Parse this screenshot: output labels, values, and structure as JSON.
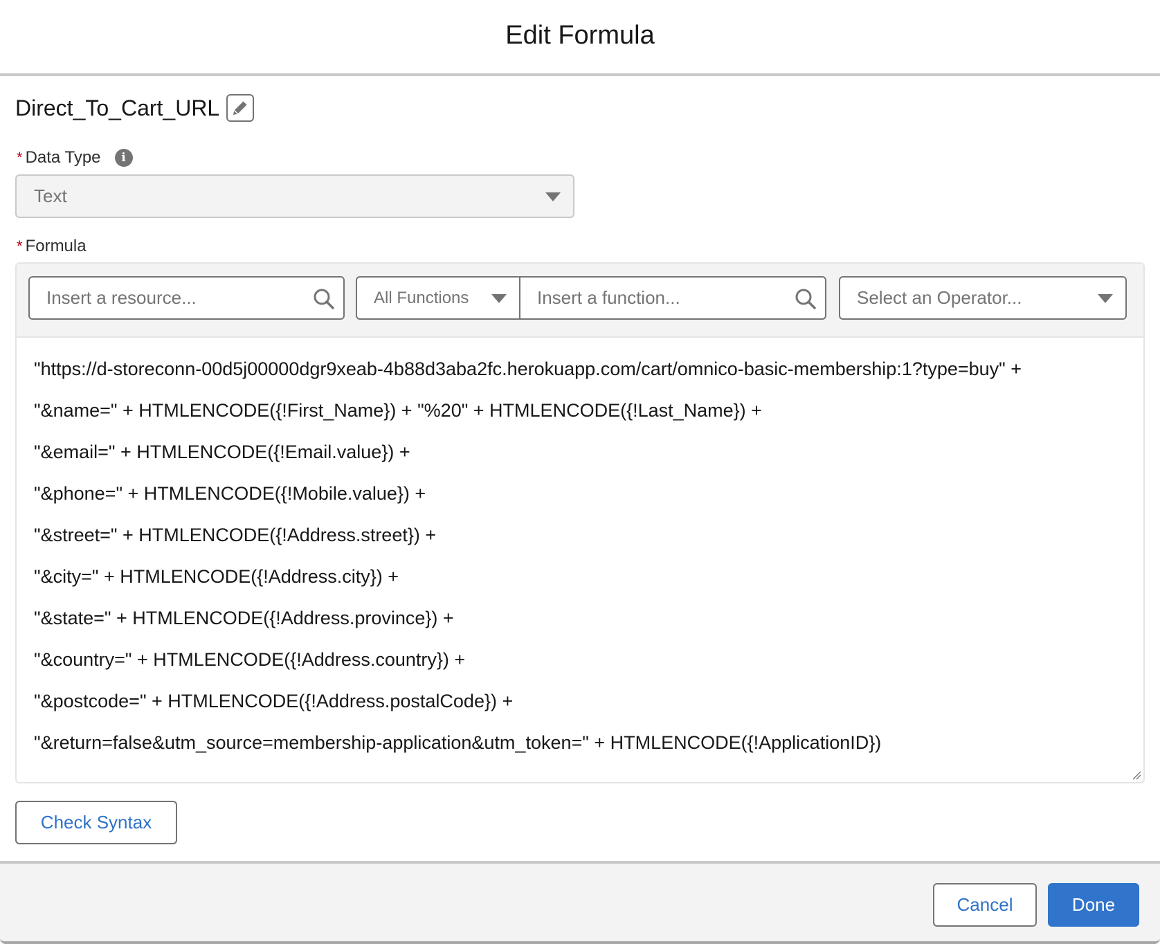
{
  "modal": {
    "title": "Edit Formula"
  },
  "field": {
    "api_name": "Direct_To_Cart_URL",
    "edit_icon": "pencil-icon"
  },
  "data_type": {
    "label": "Data Type",
    "required_marker": "*",
    "info_icon": "info-icon",
    "selected": "Text"
  },
  "formula": {
    "label": "Formula",
    "required_marker": "*",
    "toolbar": {
      "resource_placeholder": "Insert a resource...",
      "function_category": "All Functions",
      "function_placeholder": "Insert a function...",
      "operator_placeholder": "Select an Operator..."
    },
    "lines": [
      "\"https://d-storeconn-00d5j00000dgr9xeab-4b88d3aba2fc.herokuapp.com/cart/omnico-basic-membership:1?type=buy\" +",
      "\"&name=\" + HTMLENCODE({!First_Name}) + \"%20\" + HTMLENCODE({!Last_Name}) +",
      "\"&email=\" + HTMLENCODE({!Email.value}) +",
      "\"&phone=\" + HTMLENCODE({!Mobile.value}) +",
      "\"&street=\" + HTMLENCODE({!Address.street}) +",
      "\"&city=\" + HTMLENCODE({!Address.city}) +",
      "\"&state=\" + HTMLENCODE({!Address.province}) +",
      "\"&country=\" + HTMLENCODE({!Address.country}) +",
      "\"&postcode=\" + HTMLENCODE({!Address.postalCode}) +",
      "\"&return=false&utm_source=membership-application&utm_token=\" + HTMLENCODE({!ApplicationID})"
    ]
  },
  "actions": {
    "check_syntax": "Check Syntax",
    "cancel": "Cancel",
    "done": "Done"
  },
  "colors": {
    "brand": "#3174cc",
    "required": "#ba0517",
    "border": "#747474"
  }
}
